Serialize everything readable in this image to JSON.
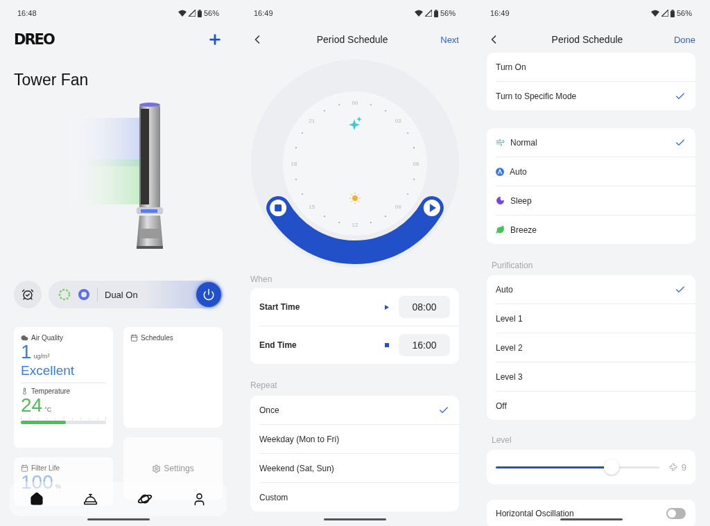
{
  "home": {
    "status_bar": {
      "time": "16:48",
      "battery": "56%"
    },
    "brand": "DREO",
    "device_name": "Tower Fan",
    "mode_bar": {
      "label": "Dual On",
      "power_on": true
    },
    "air_quality": {
      "title": "Air Quality",
      "value": "1",
      "unit": "ug/m³",
      "rating": "Excellent"
    },
    "temperature": {
      "title": "Temperature",
      "value": "24",
      "unit": "°C",
      "level": 0.53
    },
    "schedules": {
      "title": "Schedules"
    },
    "settings": {
      "title": "Settings"
    },
    "filter_life": {
      "title": "Filter Life",
      "value": "100",
      "unit": "%"
    },
    "nav": [
      {
        "kind": "home",
        "selected": true
      },
      {
        "kind": "bell",
        "selected": false
      },
      {
        "kind": "planet",
        "selected": false
      },
      {
        "kind": "profile",
        "selected": false
      }
    ]
  },
  "schedule_time": {
    "status_bar": {
      "time": "16:49",
      "battery": "56%"
    },
    "title": "Period Schedule",
    "action": "Next",
    "dial": {
      "labels": [
        "00",
        "03",
        "06",
        "09",
        "12",
        "15",
        "18",
        "21"
      ]
    },
    "when": {
      "heading": "When",
      "rows": [
        {
          "kind": "start",
          "label": "Start Time",
          "value": "08:00"
        },
        {
          "kind": "end",
          "label": "End Time",
          "value": "16:00"
        }
      ]
    },
    "repeat": {
      "heading": "Repeat",
      "options": [
        {
          "label": "Once",
          "selected": true
        },
        {
          "label": "Weekday (Mon to Fri)",
          "selected": false
        },
        {
          "label": "Weekend (Sat, Sun)",
          "selected": false
        },
        {
          "label": "Custom",
          "selected": false
        }
      ]
    }
  },
  "schedule_action": {
    "status_bar": {
      "time": "16:49",
      "battery": "56%"
    },
    "title": "Period Schedule",
    "action": "Done",
    "actions": [
      {
        "label": "Turn On",
        "selected": false
      },
      {
        "label": "Turn to Specific Mode",
        "selected": true
      }
    ],
    "modes": [
      {
        "kind": "normal",
        "label": "Normal",
        "selected": true
      },
      {
        "kind": "auto",
        "label": "Auto",
        "selected": false
      },
      {
        "kind": "sleep",
        "label": "Sleep",
        "selected": false
      },
      {
        "kind": "breeze",
        "label": "Breeze",
        "selected": false
      }
    ],
    "purification": {
      "heading": "Purification",
      "options": [
        {
          "label": "Auto",
          "selected": true
        },
        {
          "label": "Level 1",
          "selected": false
        },
        {
          "label": "Level 2",
          "selected": false
        },
        {
          "label": "Level 3",
          "selected": false
        },
        {
          "label": "Off",
          "selected": false
        }
      ]
    },
    "fan_level": {
      "heading": "Level",
      "level": 0.71,
      "reading": "9"
    },
    "oscillation": {
      "label": "Horizontal Oscillation",
      "on": false
    }
  }
}
